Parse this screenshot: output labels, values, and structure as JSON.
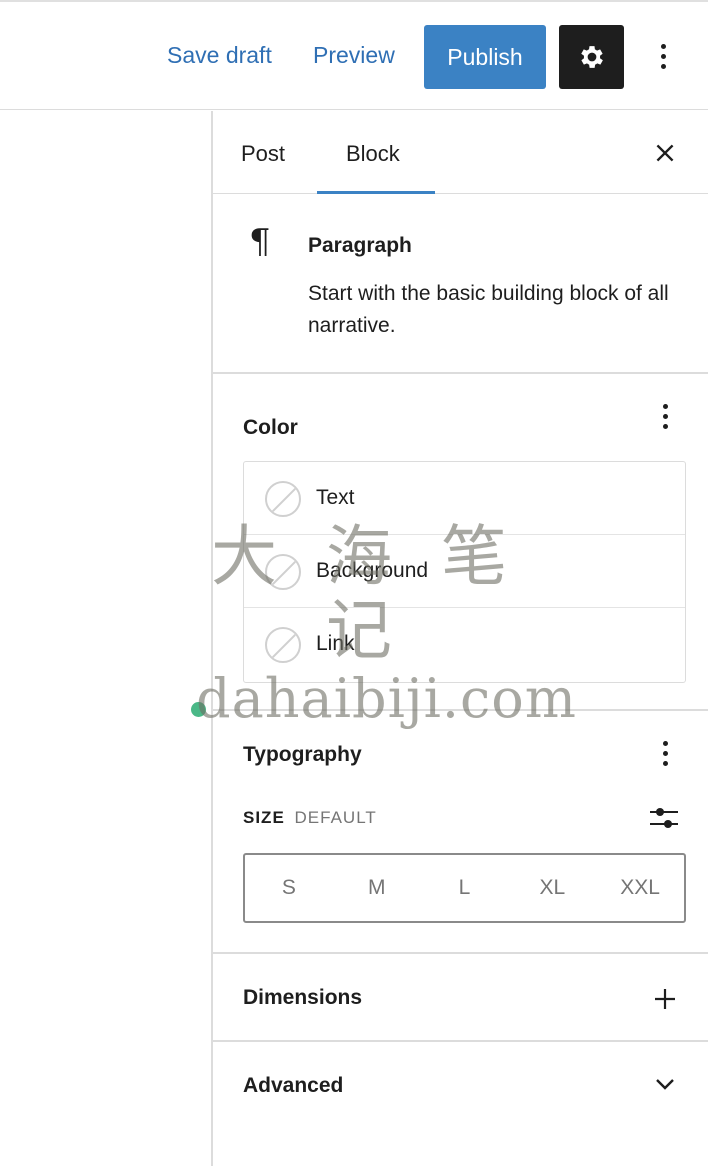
{
  "toolbar": {
    "save_draft_label": "Save draft",
    "preview_label": "Preview",
    "publish_label": "Publish",
    "settings_icon": "gear-icon",
    "more_icon": "more-vertical-icon",
    "accent_color": "#3b82c4"
  },
  "sidebar": {
    "tabs": [
      {
        "label": "Post",
        "active": false
      },
      {
        "label": "Block",
        "active": true
      }
    ],
    "close_icon": "close-icon"
  },
  "block_card": {
    "icon": "paragraph-icon",
    "icon_glyph": "¶",
    "title": "Paragraph",
    "description": "Start with the basic building block of all narrative."
  },
  "color_panel": {
    "title": "Color",
    "items": [
      {
        "label": "Text"
      },
      {
        "label": "Background"
      },
      {
        "label": "Link"
      }
    ]
  },
  "typography_panel": {
    "title": "Typography",
    "size_label": "SIZE",
    "size_value": "DEFAULT",
    "size_options": [
      "S",
      "M",
      "L",
      "XL",
      "XXL"
    ]
  },
  "dimensions_panel": {
    "title": "Dimensions",
    "icon": "plus-icon"
  },
  "advanced_panel": {
    "title": "Advanced",
    "icon": "chevron-down-icon"
  },
  "watermark": {
    "line1": "大 海 笔 记",
    "line2": "dahaibiji.com"
  }
}
